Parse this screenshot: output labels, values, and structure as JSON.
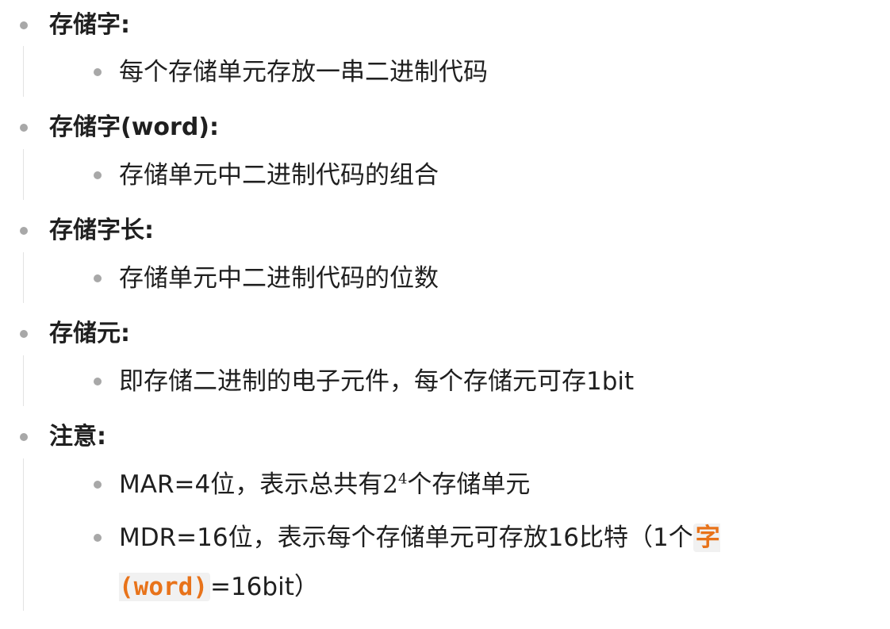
{
  "items": [
    {
      "term": "存储字:",
      "details": [
        "每个存储单元存放一串二进制代码"
      ]
    },
    {
      "term": "存储字(word):",
      "details": [
        "存储单元中二进制代码的组合"
      ]
    },
    {
      "term": "存储字长:",
      "details": [
        "存储单元中二进制代码的位数"
      ]
    },
    {
      "term": "存储元:",
      "details": [
        "即存储二进制的电子元件，每个存储元可存1bit"
      ]
    }
  ],
  "note": {
    "term": "注意:",
    "mar_prefix": "MAR=4位，表示总共有",
    "mar_base": "2",
    "mar_exp": "4",
    "mar_suffix": "个存储单元",
    "mdr_prefix": "MDR=16位，表示每个存储单元可存放16比特（1个",
    "mdr_code": "字(word)",
    "mdr_suffix": "=16bit）"
  },
  "colors": {
    "code": "#e8731a",
    "bullet": "#a8a8a8"
  }
}
